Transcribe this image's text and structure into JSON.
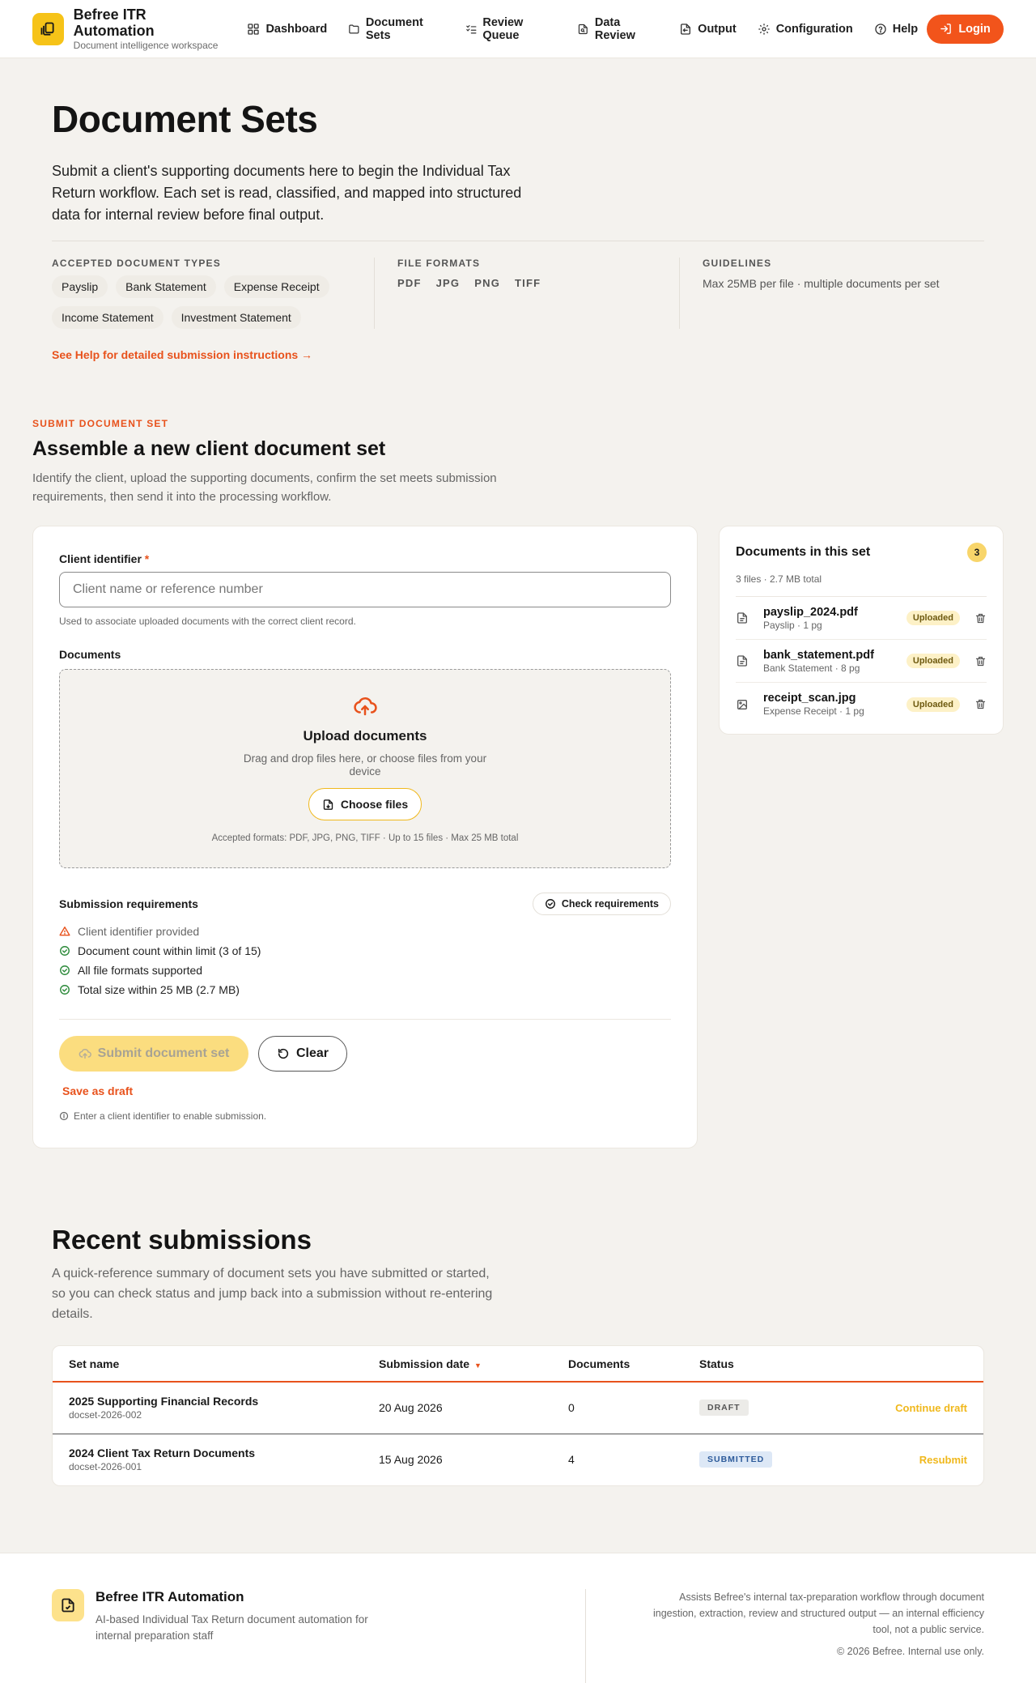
{
  "header": {
    "brand_title": "Befree ITR Automation",
    "brand_subtitle": "Document intelligence workspace",
    "nav": [
      {
        "label": "Dashboard",
        "icon": "grid-icon"
      },
      {
        "label": "Document Sets",
        "icon": "folder-icon"
      },
      {
        "label": "Review Queue",
        "icon": "checklist-icon"
      },
      {
        "label": "Data Review",
        "icon": "file-search-icon"
      },
      {
        "label": "Output",
        "icon": "export-icon"
      },
      {
        "label": "Configuration",
        "icon": "gear-icon"
      },
      {
        "label": "Help",
        "icon": "help-circle-icon"
      }
    ],
    "login_label": "Login"
  },
  "hero": {
    "title": "Document Sets",
    "intro": "Submit a client's supporting documents here to begin the Individual Tax Return workflow. Each set is read, classified, and mapped into structured data for internal review before final output.",
    "accepted_label": "ACCEPTED DOCUMENT TYPES",
    "accepted_types": [
      "Payslip",
      "Bank Statement",
      "Expense Receipt",
      "Income Statement",
      "Investment Statement"
    ],
    "formats_label": "FILE FORMATS",
    "formats": [
      "PDF",
      "JPG",
      "PNG",
      "TIFF"
    ],
    "guidelines_label": "GUIDELINES",
    "guidelines": "Max 25MB per file · multiple documents per set",
    "help_link": "See Help for detailed submission instructions →"
  },
  "submit": {
    "eyebrow": "SUBMIT DOCUMENT SET",
    "title": "Assemble a new client document set",
    "lead": "Identify the client, upload the supporting documents, confirm the set meets submission requirements, then send it into the processing workflow.",
    "client_label": "Client identifier",
    "required_mark": "*",
    "client_placeholder": "Client name or reference number",
    "client_hint": "Used to associate uploaded documents with the correct client record.",
    "documents_label": "Documents",
    "upload_title": "Upload documents",
    "upload_sub": "Drag and drop files here, or choose files from your device",
    "choose_label": "Choose files",
    "upload_formats": "Accepted formats: PDF, JPG, PNG, TIFF · Up to 15 files · Max 25 MB total",
    "requirements_label": "Submission requirements",
    "check_label": "Check requirements",
    "requirements": [
      {
        "text": "Client identifier provided",
        "status": "warning"
      },
      {
        "text": "Document count within limit (3 of 15)",
        "status": "ok"
      },
      {
        "text": "All file formats supported",
        "status": "ok"
      },
      {
        "text": "Total size within 25 MB (2.7 MB)",
        "status": "ok"
      }
    ],
    "submit_label": "Submit document set",
    "clear_label": "Clear",
    "draft_label": "Save as draft",
    "enable_hint": "Enter a client identifier to enable submission."
  },
  "set_panel": {
    "title": "Documents in this set",
    "count": "3",
    "summary": "3 files · 2.7 MB total",
    "documents": [
      {
        "name": "payslip_2024.pdf",
        "meta": "Payslip · 1 pg",
        "status": "Uploaded",
        "icon": "file-text-icon"
      },
      {
        "name": "bank_statement.pdf",
        "meta": "Bank Statement · 8 pg",
        "status": "Uploaded",
        "icon": "file-text-icon"
      },
      {
        "name": "receipt_scan.jpg",
        "meta": "Expense Receipt · 1 pg",
        "status": "Uploaded",
        "icon": "image-icon"
      }
    ]
  },
  "recent": {
    "title": "Recent submissions",
    "lead": "A quick-reference summary of document sets you have submitted or started, so you can check status and jump back into a submission without re-entering details.",
    "columns": [
      "Set name",
      "Submission date",
      "Documents",
      "Status"
    ],
    "sort_indicator": "▼",
    "rows": [
      {
        "name": "2025 Supporting Financial Records",
        "id": "docset-2026-002",
        "date": "20 Aug 2026",
        "documents": "0",
        "status": "DRAFT",
        "action": "Continue draft"
      },
      {
        "name": "2024 Client Tax Return Documents",
        "id": "docset-2026-001",
        "date": "15 Aug 2026",
        "documents": "4",
        "status": "SUBMITTED",
        "action": "Resubmit"
      }
    ]
  },
  "footer": {
    "title": "Befree ITR Automation",
    "subtitle": "AI-based Individual Tax Return document automation for internal preparation staff",
    "description": "Assists Befree's internal tax-preparation workflow through document ingestion, extraction, review and structured output — an internal efficiency tool, not a public service.",
    "copyright": "© 2026 Befree. Internal use only."
  },
  "colors": {
    "accent": "#e8521c",
    "brand_yellow": "#f6c318",
    "background": "#f4f2ee"
  }
}
